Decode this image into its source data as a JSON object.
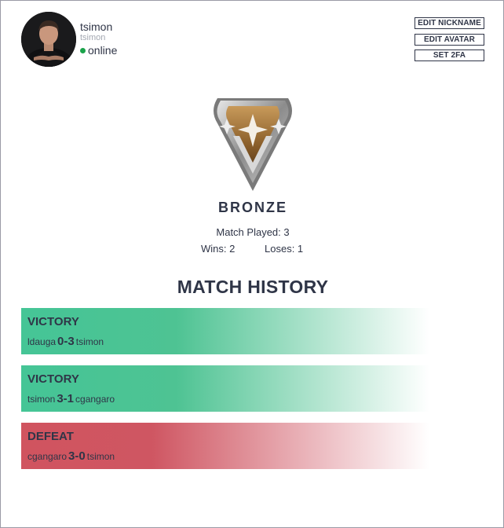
{
  "profile": {
    "display_name": "tsimon",
    "login": "tsimon",
    "status": "online",
    "status_color": "#1aa34a"
  },
  "actions": {
    "edit_nickname": "EDIT NICKNAME",
    "edit_avatar": "EDIT AVATAR",
    "set_2fa": "SET 2FA"
  },
  "rank": {
    "name": "BRONZE",
    "match_played": "Match Played: 3",
    "wins": "Wins: 2",
    "loses": "Loses: 1"
  },
  "history": {
    "title": "MATCH HISTORY",
    "matches": [
      {
        "result": "VICTORY",
        "player_left": "ldauga",
        "score": "0-3",
        "player_right": "tsimon"
      },
      {
        "result": "VICTORY",
        "player_left": "tsimon",
        "score": "3-1",
        "player_right": "cgangaro"
      },
      {
        "result": "DEFEAT",
        "player_left": "cgangaro",
        "score": "3-0",
        "player_right": "tsimon"
      }
    ]
  },
  "colors": {
    "text": "#2f3547",
    "victory": "#45c596",
    "defeat": "#d0545f"
  },
  "icons": {
    "avatar": "user-avatar-photo",
    "rank": "bronze-rank-icon"
  }
}
